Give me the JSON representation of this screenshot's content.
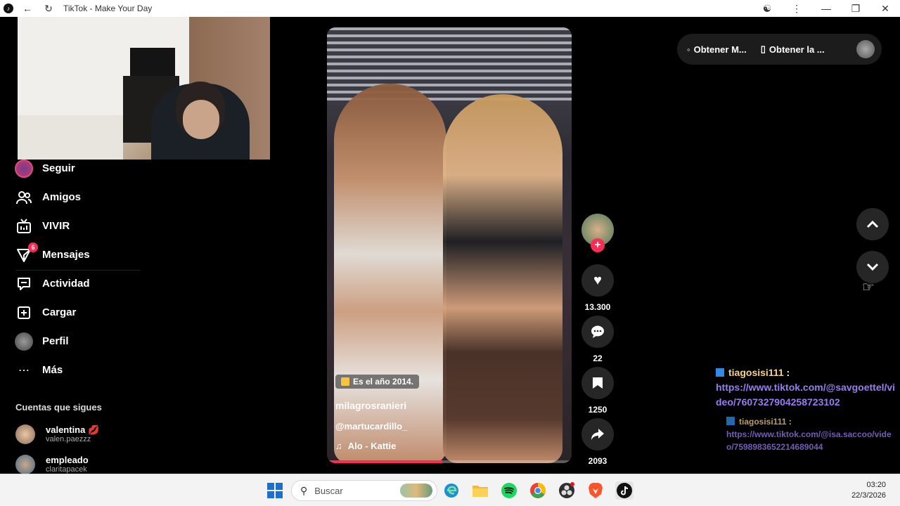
{
  "window": {
    "title": "TikTok - Make Your Day"
  },
  "sidebar": {
    "items": [
      {
        "label": "Seguir"
      },
      {
        "label": "Amigos"
      },
      {
        "label": "VIVIR"
      },
      {
        "label": "Mensajes",
        "badge": "6"
      },
      {
        "label": "Actividad"
      },
      {
        "label": "Cargar"
      },
      {
        "label": "Perfil"
      },
      {
        "label": "Más"
      }
    ],
    "following_title": "Cuentas que sigues",
    "following": [
      {
        "name": "valentina 💋",
        "handle": "valen.paezzz"
      },
      {
        "name": "empleado",
        "handle": "claritapacek"
      }
    ]
  },
  "top_actions": {
    "get_m": "Obtener M...",
    "get_app": "Obtener la ..."
  },
  "video": {
    "tag": "Es el año 2014.",
    "author": "milagrosranieri",
    "mention": "@martucardillo_",
    "music": "Alo - Kattie",
    "progress": 0.47
  },
  "actions": {
    "likes": "13.300",
    "comments": "22",
    "saves": "1250",
    "shares": "2093"
  },
  "chat": [
    {
      "user": "tiagosisi111",
      "link": "https://www.tiktok.com/@savgoettel/video/7607327904258723102"
    },
    {
      "user": "tiagosisi111",
      "link": "https://www.tiktok.com/@isa.saccoo/video/7598983652214689044"
    }
  ],
  "taskbar": {
    "search_placeholder": "Buscar",
    "time": "03:20",
    "date": "22/3/2026"
  },
  "colors": {
    "accent": "#fe2c55",
    "link": "#9b7cf0",
    "username": "#f5d28b"
  }
}
